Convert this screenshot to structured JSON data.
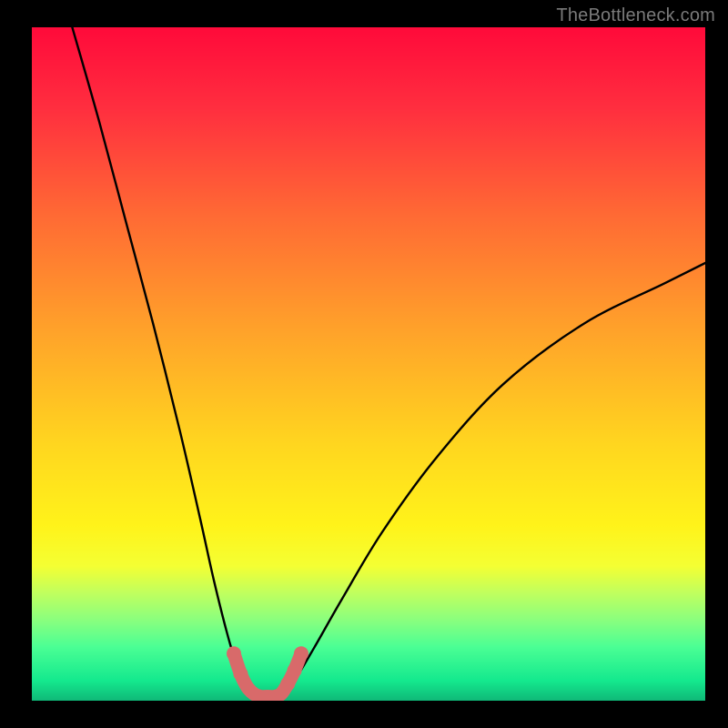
{
  "watermark": "TheBottleneck.com",
  "chart_data": {
    "type": "line",
    "title": "",
    "xlabel": "",
    "ylabel": "",
    "xlim": [
      0,
      100
    ],
    "ylim": [
      0,
      100
    ],
    "grid": false,
    "legend": false,
    "gradient_stops": [
      {
        "offset": 0,
        "color": "#ff0a3a"
      },
      {
        "offset": 12,
        "color": "#ff2e3f"
      },
      {
        "offset": 28,
        "color": "#ff6a34"
      },
      {
        "offset": 45,
        "color": "#ffa22a"
      },
      {
        "offset": 62,
        "color": "#ffd61f"
      },
      {
        "offset": 74,
        "color": "#fff31a"
      },
      {
        "offset": 80,
        "color": "#f4ff33"
      },
      {
        "offset": 84,
        "color": "#c0ff5e"
      },
      {
        "offset": 88,
        "color": "#8aff7e"
      },
      {
        "offset": 92,
        "color": "#4bff94"
      },
      {
        "offset": 97,
        "color": "#14e98e"
      },
      {
        "offset": 100,
        "color": "#0fb878"
      }
    ],
    "series": [
      {
        "name": "left-curve",
        "x": [
          6,
          10,
          14,
          18,
          22,
          25,
          27,
          29,
          30.5,
          31.8,
          33
        ],
        "y": [
          100,
          86,
          71,
          56,
          40,
          27,
          18,
          10,
          5,
          2,
          0.5
        ]
      },
      {
        "name": "right-curve",
        "x": [
          37,
          39,
          42,
          46,
          52,
          60,
          70,
          82,
          94,
          100
        ],
        "y": [
          0.5,
          3,
          8,
          15,
          25,
          36,
          47,
          56,
          62,
          65
        ]
      },
      {
        "name": "valley-marker",
        "x": [
          30,
          31,
          32,
          33,
          34,
          35,
          36,
          37,
          38,
          39,
          40
        ],
        "y": [
          7,
          4,
          2,
          1,
          0.6,
          0.6,
          0.6,
          1,
          2.5,
          4.5,
          7
        ]
      }
    ],
    "marker_points_left": [
      [
        30,
        7
      ],
      [
        31,
        4
      ]
    ],
    "marker_points_right": [
      [
        38,
        2.5
      ],
      [
        39,
        4.5
      ],
      [
        40,
        7
      ]
    ],
    "colors": {
      "curve": "#000000",
      "marker": "#d86a6a",
      "marker_stroke": "#c95a5a"
    }
  }
}
